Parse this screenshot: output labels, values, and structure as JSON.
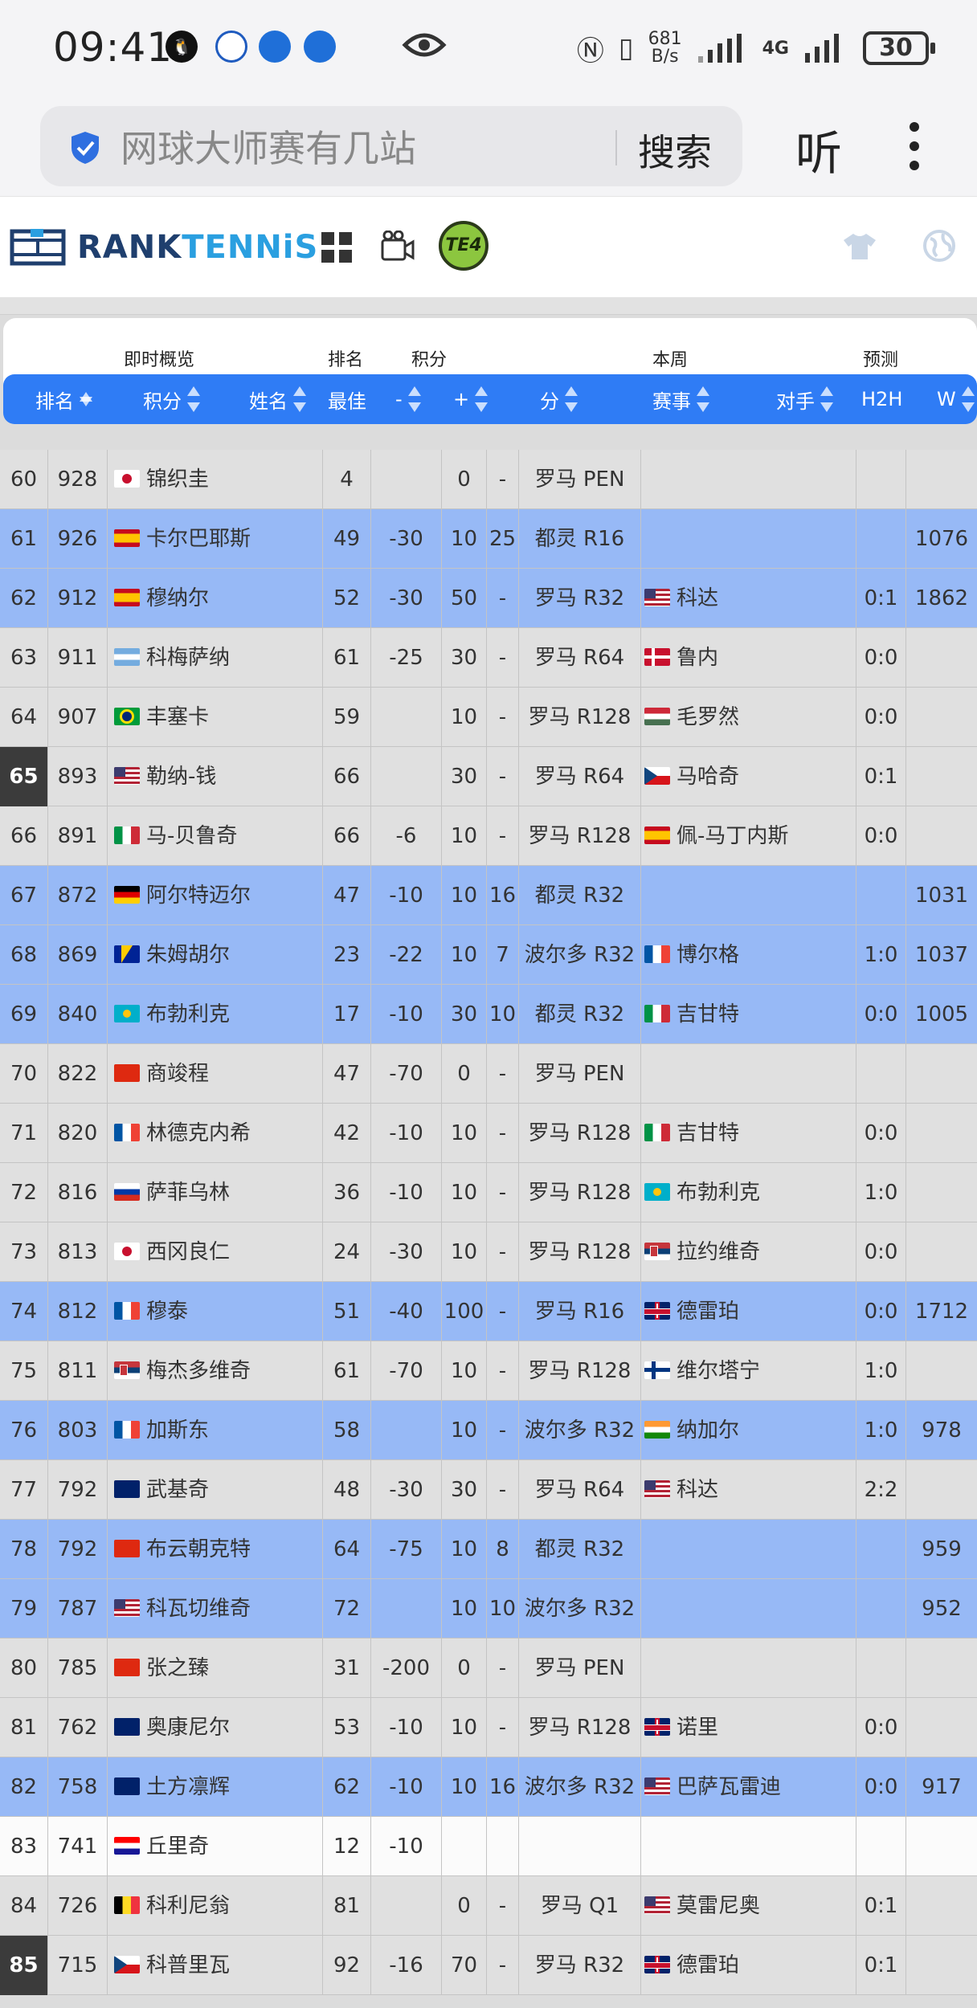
{
  "status_bar": {
    "time": "09:41",
    "net_speed_value": "681",
    "net_speed_unit": "B/s",
    "network": "4G",
    "battery": "30"
  },
  "browser": {
    "search_query": "网球大师赛有几站",
    "search_button": "搜索",
    "listen_button": "听"
  },
  "site": {
    "logo_rank": "RANK",
    "logo_tennis": "TENNiS",
    "badge_text": "TE4"
  },
  "table": {
    "group_headers": {
      "live": "即时概览",
      "rank": "排名",
      "points": "积分",
      "this_week": "本周",
      "forecast": "预测"
    },
    "column_headers": {
      "rank": "排名",
      "points": "积分",
      "name": "姓名",
      "best": "最佳",
      "minus": "-",
      "plus": "+",
      "score": "分",
      "event": "赛事",
      "opponent": "对手",
      "h2h": "H2H",
      "w": "W"
    },
    "rows": [
      {
        "rank": "60",
        "points": "928",
        "flag": "JP",
        "name": "锦织圭",
        "best": "4",
        "minus": "",
        "plus": "0",
        "week": "-",
        "event": "罗马 PEN",
        "opp_flag": "",
        "opponent": "",
        "h2h": "",
        "w": "",
        "style": "gray",
        "selected": false
      },
      {
        "rank": "61",
        "points": "926",
        "flag": "ES",
        "name": "卡尔巴耶斯",
        "best": "49",
        "minus": "-30",
        "plus": "10",
        "week": "25",
        "event": "都灵 R16",
        "opp_flag": "",
        "opponent": "",
        "h2h": "",
        "w": "1076",
        "style": "hl",
        "selected": false
      },
      {
        "rank": "62",
        "points": "912",
        "flag": "ES",
        "name": "穆纳尔",
        "best": "52",
        "minus": "-30",
        "plus": "50",
        "week": "-",
        "event": "罗马 R32",
        "opp_flag": "US",
        "opponent": "科达",
        "h2h": "0:1",
        "w": "1862",
        "style": "hl",
        "selected": false
      },
      {
        "rank": "63",
        "points": "911",
        "flag": "AR",
        "name": "科梅萨纳",
        "best": "61",
        "minus": "-25",
        "plus": "30",
        "week": "-",
        "event": "罗马 R64",
        "opp_flag": "DK",
        "opponent": "鲁内",
        "h2h": "0:0",
        "w": "",
        "style": "gray",
        "selected": false
      },
      {
        "rank": "64",
        "points": "907",
        "flag": "BR",
        "name": "丰塞卡",
        "best": "59",
        "minus": "",
        "plus": "10",
        "week": "-",
        "event": "罗马 R128",
        "opp_flag": "HU",
        "opponent": "毛罗然",
        "h2h": "0:0",
        "w": "",
        "style": "gray",
        "selected": false
      },
      {
        "rank": "65",
        "points": "893",
        "flag": "US",
        "name": "勒纳-钱",
        "best": "66",
        "minus": "",
        "plus": "30",
        "week": "-",
        "event": "罗马 R64",
        "opp_flag": "CZ",
        "opponent": "马哈奇",
        "h2h": "0:1",
        "w": "",
        "style": "gray",
        "selected": true
      },
      {
        "rank": "66",
        "points": "891",
        "flag": "IT",
        "name": "马-贝鲁奇",
        "best": "66",
        "minus": "-6",
        "plus": "10",
        "week": "-",
        "event": "罗马 R128",
        "opp_flag": "ES",
        "opponent": "佩-马丁内斯",
        "h2h": "0:0",
        "w": "",
        "style": "gray",
        "selected": false
      },
      {
        "rank": "67",
        "points": "872",
        "flag": "DE",
        "name": "阿尔特迈尔",
        "best": "47",
        "minus": "-10",
        "plus": "10",
        "week": "16",
        "event": "都灵 R32",
        "opp_flag": "",
        "opponent": "",
        "h2h": "",
        "w": "1031",
        "style": "hl",
        "selected": false
      },
      {
        "rank": "68",
        "points": "869",
        "flag": "BA",
        "name": "朱姆胡尔",
        "best": "23",
        "minus": "-22",
        "plus": "10",
        "week": "7",
        "event": "波尔多 R32",
        "opp_flag": "FR",
        "opponent": "博尔格",
        "h2h": "1:0",
        "w": "1037",
        "style": "hl",
        "selected": false
      },
      {
        "rank": "69",
        "points": "840",
        "flag": "KZ",
        "name": "布勃利克",
        "best": "17",
        "minus": "-10",
        "plus": "30",
        "week": "10",
        "event": "都灵 R32",
        "opp_flag": "IT",
        "opponent": "吉甘特",
        "h2h": "0:0",
        "w": "1005",
        "style": "hl",
        "selected": false
      },
      {
        "rank": "70",
        "points": "822",
        "flag": "CN",
        "name": "商竣程",
        "best": "47",
        "minus": "-70",
        "plus": "0",
        "week": "-",
        "event": "罗马 PEN",
        "opp_flag": "",
        "opponent": "",
        "h2h": "",
        "w": "",
        "style": "gray",
        "selected": false
      },
      {
        "rank": "71",
        "points": "820",
        "flag": "FR",
        "name": "林德克内希",
        "best": "42",
        "minus": "-10",
        "plus": "10",
        "week": "-",
        "event": "罗马 R128",
        "opp_flag": "IT",
        "opponent": "吉甘特",
        "h2h": "0:0",
        "w": "",
        "style": "gray",
        "selected": false
      },
      {
        "rank": "72",
        "points": "816",
        "flag": "RU",
        "name": "萨菲乌林",
        "best": "36",
        "minus": "-10",
        "plus": "10",
        "week": "-",
        "event": "罗马 R128",
        "opp_flag": "KZ",
        "opponent": "布勃利克",
        "h2h": "1:0",
        "w": "",
        "style": "gray",
        "selected": false
      },
      {
        "rank": "73",
        "points": "813",
        "flag": "JP",
        "name": "西冈良仁",
        "best": "24",
        "minus": "-30",
        "plus": "10",
        "week": "-",
        "event": "罗马 R128",
        "opp_flag": "RS",
        "opponent": "拉约维奇",
        "h2h": "0:0",
        "w": "",
        "style": "gray",
        "selected": false
      },
      {
        "rank": "74",
        "points": "812",
        "flag": "FR",
        "name": "穆泰",
        "best": "51",
        "minus": "-40",
        "plus": "100",
        "week": "-",
        "event": "罗马 R16",
        "opp_flag": "GB",
        "opponent": "德雷珀",
        "h2h": "0:0",
        "w": "1712",
        "style": "hl",
        "selected": false
      },
      {
        "rank": "75",
        "points": "811",
        "flag": "RS",
        "name": "梅杰多维奇",
        "best": "61",
        "minus": "-70",
        "plus": "10",
        "week": "-",
        "event": "罗马 R128",
        "opp_flag": "FI",
        "opponent": "维尔塔宁",
        "h2h": "1:0",
        "w": "",
        "style": "gray",
        "selected": false
      },
      {
        "rank": "76",
        "points": "803",
        "flag": "FR",
        "name": "加斯东",
        "best": "58",
        "minus": "",
        "plus": "10",
        "week": "-",
        "event": "波尔多 R32",
        "opp_flag": "IN",
        "opponent": "纳加尔",
        "h2h": "1:0",
        "w": "978",
        "style": "hl",
        "selected": false
      },
      {
        "rank": "77",
        "points": "792",
        "flag": "AU",
        "name": "武基奇",
        "best": "48",
        "minus": "-30",
        "plus": "30",
        "week": "-",
        "event": "罗马 R64",
        "opp_flag": "US",
        "opponent": "科达",
        "h2h": "2:2",
        "w": "",
        "style": "gray",
        "selected": false
      },
      {
        "rank": "78",
        "points": "792",
        "flag": "CN",
        "name": "布云朝克特",
        "best": "64",
        "minus": "-75",
        "plus": "10",
        "week": "8",
        "event": "都灵 R32",
        "opp_flag": "",
        "opponent": "",
        "h2h": "",
        "w": "959",
        "style": "hl",
        "selected": false
      },
      {
        "rank": "79",
        "points": "787",
        "flag": "US",
        "name": "科瓦切维奇",
        "best": "72",
        "minus": "",
        "plus": "10",
        "week": "10",
        "event": "波尔多 R32",
        "opp_flag": "",
        "opponent": "",
        "h2h": "",
        "w": "952",
        "style": "hl",
        "selected": false
      },
      {
        "rank": "80",
        "points": "785",
        "flag": "CN",
        "name": "张之臻",
        "best": "31",
        "minus": "-200",
        "plus": "0",
        "week": "-",
        "event": "罗马 PEN",
        "opp_flag": "",
        "opponent": "",
        "h2h": "",
        "w": "",
        "style": "gray",
        "selected": false
      },
      {
        "rank": "81",
        "points": "762",
        "flag": "AU",
        "name": "奥康尼尔",
        "best": "53",
        "minus": "-10",
        "plus": "10",
        "week": "-",
        "event": "罗马 R128",
        "opp_flag": "GB",
        "opponent": "诺里",
        "h2h": "0:0",
        "w": "",
        "style": "gray",
        "selected": false
      },
      {
        "rank": "82",
        "points": "758",
        "flag": "AU",
        "name": "土方凛辉",
        "best": "62",
        "minus": "-10",
        "plus": "10",
        "week": "16",
        "event": "波尔多 R32",
        "opp_flag": "US",
        "opponent": "巴萨瓦雷迪",
        "h2h": "0:0",
        "w": "917",
        "style": "hl",
        "selected": false
      },
      {
        "rank": "83",
        "points": "741",
        "flag": "HR",
        "name": "丘里奇",
        "best": "12",
        "minus": "-10",
        "plus": "",
        "week": "",
        "event": "",
        "opp_flag": "",
        "opponent": "",
        "h2h": "",
        "w": "",
        "style": "white",
        "selected": false
      },
      {
        "rank": "84",
        "points": "726",
        "flag": "BE",
        "name": "科利尼翁",
        "best": "81",
        "minus": "",
        "plus": "0",
        "week": "-",
        "event": "罗马 Q1",
        "opp_flag": "US",
        "opponent": "莫雷尼奥",
        "h2h": "0:1",
        "w": "",
        "style": "gray",
        "selected": false
      },
      {
        "rank": "85",
        "points": "715",
        "flag": "CZ",
        "name": "科普里瓦",
        "best": "92",
        "minus": "-16",
        "plus": "70",
        "week": "-",
        "event": "罗马 R32",
        "opp_flag": "GB",
        "opponent": "德雷珀",
        "h2h": "0:1",
        "w": "",
        "style": "gray",
        "selected": true
      }
    ]
  },
  "colors": {
    "header_blue": "#2f7cf5",
    "row_highlight": "#97b9f6",
    "row_gray": "#e0e0e0",
    "selected_rank": "#3b3b3b"
  }
}
